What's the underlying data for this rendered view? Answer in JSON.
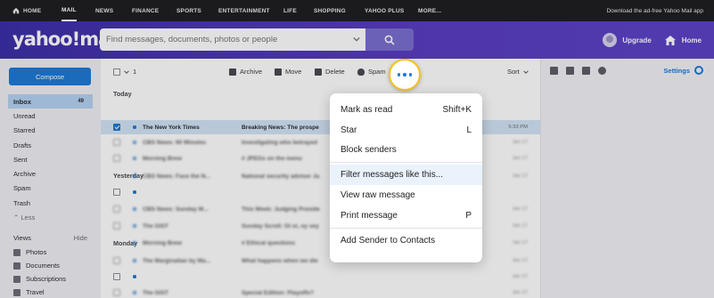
{
  "topnav": {
    "items": [
      "HOME",
      "MAIL",
      "NEWS",
      "FINANCE",
      "SPORTS",
      "ENTERTAINMENT",
      "LIFE",
      "SHOPPING",
      "YAHOO PLUS",
      "MORE..."
    ],
    "promo": "Download the ad-free Yahoo Mail app"
  },
  "header": {
    "logo": "yahoo!mail",
    "search_placeholder": "Find messages, documents, photos or people",
    "upgrade": "Upgrade",
    "home": "Home"
  },
  "sidebar": {
    "compose": "Compose",
    "folders": [
      {
        "label": "Inbox",
        "count": "49"
      },
      {
        "label": "Unread",
        "count": ""
      },
      {
        "label": "Starred",
        "count": ""
      },
      {
        "label": "Drafts",
        "count": ""
      },
      {
        "label": "Sent",
        "count": ""
      },
      {
        "label": "Archive",
        "count": ""
      },
      {
        "label": "Spam",
        "count": ""
      },
      {
        "label": "Trash",
        "count": ""
      },
      {
        "label": "⌃ Less",
        "count": ""
      }
    ],
    "views_label": "Views",
    "views_hide": "Hide",
    "views": [
      "Photos",
      "Documents",
      "Subscriptions",
      "Travel"
    ]
  },
  "toolbar": {
    "selected_count": "1",
    "archive": "Archive",
    "move": "Move",
    "delete": "Delete",
    "spam": "Spam",
    "sort": "Sort"
  },
  "list": {
    "today": "Today",
    "yesterday": "Yesterday",
    "monday": "Monday",
    "rows": [
      {
        "sender": "The New York Times",
        "subject": "Breaking News: The prospe",
        "date": "5:33 PM",
        "checked": true,
        "unread": true
      },
      {
        "sender": "CBS News: 60 Minutes",
        "subject": "Investigating who betrayed",
        "date": "Jan 17",
        "checked": false,
        "unread": true
      },
      {
        "sender": "Morning Brew",
        "subject": "# JPEGs on the menu",
        "date": "Jan 17",
        "checked": false,
        "unread": true
      },
      {
        "sender": "CBS News: Face the N...",
        "subject": "National security adviser Ja",
        "date": "Jan 17",
        "checked": false,
        "unread": true
      },
      {
        "sender": "",
        "subject": "",
        "date": "",
        "checked": false,
        "unread": true
      },
      {
        "sender": "CBS News: Sunday M...",
        "subject": "This Week: Judging Preside",
        "date": "Jan 17",
        "checked": false,
        "unread": true
      },
      {
        "sender": "The GIST",
        "subject": "Sunday Scroll: Oi oi, oy vey",
        "date": "Jan 17",
        "checked": false,
        "unread": true
      },
      {
        "sender": "Morning Brew",
        "subject": "# Ethical questions",
        "date": "Jan 17",
        "checked": false,
        "unread": true
      },
      {
        "sender": "The Marginalian by Ma...",
        "subject": "What happens when we die",
        "date": "Jan 17",
        "checked": false,
        "unread": true
      },
      {
        "sender": "",
        "subject": "",
        "date": "Jan 17",
        "checked": false,
        "unread": true
      },
      {
        "sender": "The GIST",
        "subject": "Special Edition: Playoffs?",
        "date": "Jan 17",
        "checked": false,
        "unread": true
      }
    ]
  },
  "rpane": {
    "settings": "Settings"
  },
  "menu": {
    "items": [
      {
        "label": "Mark as read",
        "shortcut": "Shift+K"
      },
      {
        "label": "Star",
        "shortcut": "L"
      },
      {
        "label": "Block senders",
        "shortcut": ""
      },
      {
        "label": "Filter messages like this...",
        "shortcut": ""
      },
      {
        "label": "View raw message",
        "shortcut": ""
      },
      {
        "label": "Print message",
        "shortcut": "P"
      },
      {
        "label": "Add Sender to Contacts",
        "shortcut": ""
      }
    ]
  },
  "colors": {
    "brand_purple": "#5a3ec2",
    "accent_blue": "#1e7ad6",
    "highlight_ring": "#f6c21b"
  }
}
